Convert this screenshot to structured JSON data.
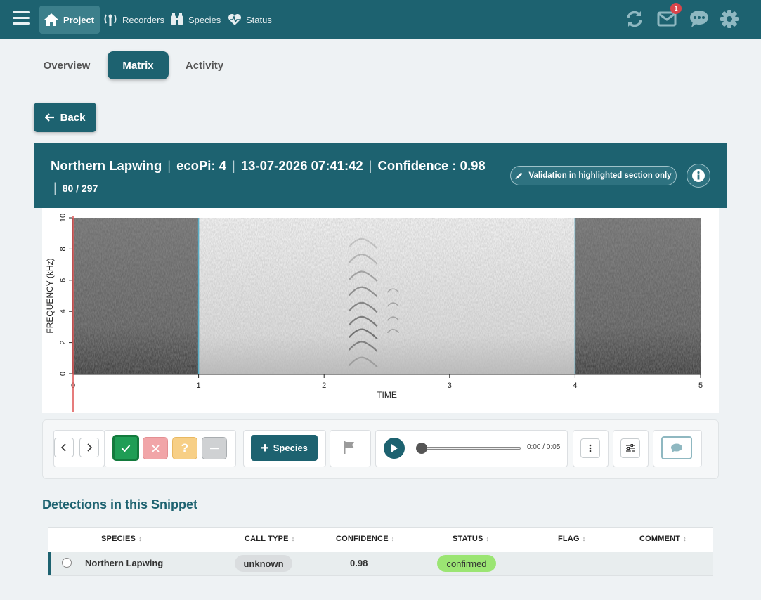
{
  "nav": {
    "items": [
      {
        "label": "Project",
        "icon": "home-icon"
      },
      {
        "label": "Recorders",
        "icon": "antenna-icon"
      },
      {
        "label": "Species",
        "icon": "binoculars-icon"
      },
      {
        "label": "Status",
        "icon": "heartbeat-icon"
      }
    ],
    "mail_badge": "1"
  },
  "tabs": [
    {
      "label": "Overview"
    },
    {
      "label": "Matrix"
    },
    {
      "label": "Activity"
    }
  ],
  "back_label": "Back",
  "banner": {
    "species": "Northern Lapwing",
    "recorder": "ecoPi: 4",
    "datetime": "13-07-2026 07:41:42",
    "confidence": "Confidence : 0.98",
    "position": "80 / 297",
    "validation_label": "Validation in highlighted section only"
  },
  "spectrogram": {
    "ylabel": "FREQUENCY (kHz)",
    "xlabel": "TIME",
    "y_ticks": [
      "0",
      "2",
      "4",
      "6",
      "8",
      "10"
    ],
    "x_ticks": [
      "0",
      "1",
      "2",
      "3",
      "4",
      "5"
    ],
    "highlight_seconds": [
      1,
      4
    ],
    "duration_seconds": 5,
    "max_khz": 10
  },
  "controls": {
    "species_label": "Species",
    "time_display": "0:00 / 0:05",
    "progress": 0
  },
  "detections": {
    "title": "Detections in this Snippet",
    "columns": [
      "SPECIES",
      "CALL TYPE",
      "CONFIDENCE",
      "STATUS",
      "FLAG",
      "COMMENT"
    ],
    "rows": [
      {
        "species": "Northern Lapwing",
        "call_type": "unknown",
        "confidence": "0.98",
        "status": "confirmed",
        "flag": "",
        "comment": ""
      }
    ]
  },
  "colors": {
    "primary": "#1d6270",
    "confirmed": "#9be573",
    "highlight_border": "#5aaec6"
  }
}
